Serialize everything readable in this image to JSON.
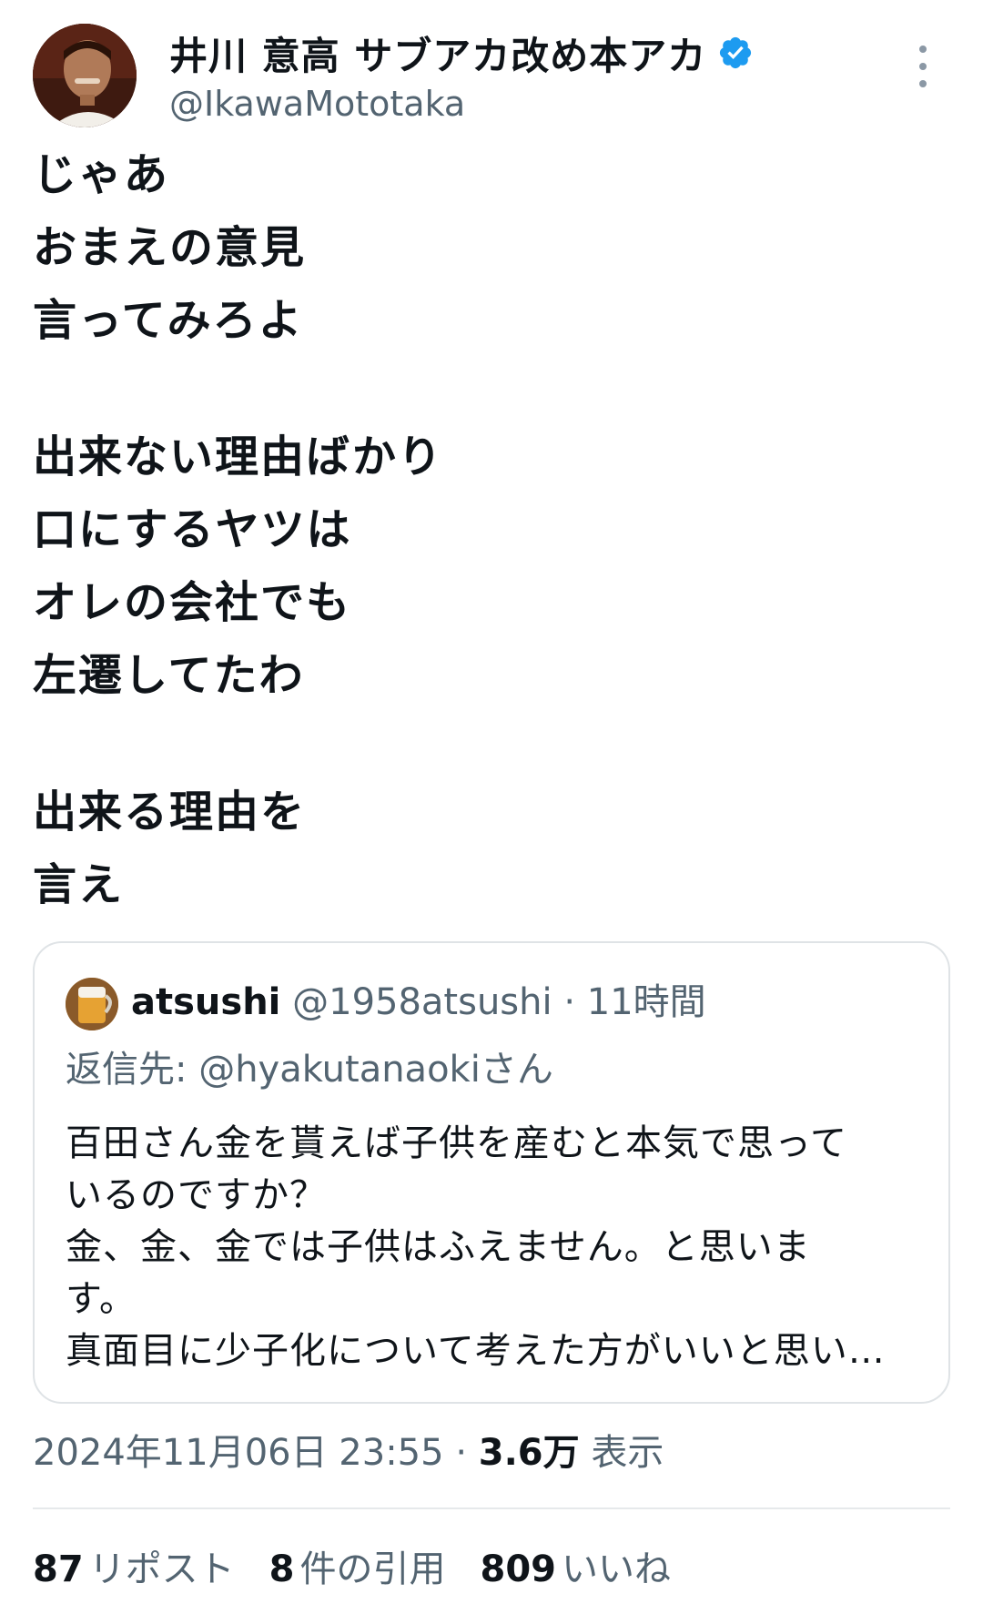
{
  "author": {
    "display_name": "井川 意高 サブアカ改め本アカ",
    "handle": "@IkawaMototaka",
    "verified": true
  },
  "tweet": {
    "lines": [
      "じゃあ",
      "おまえの意見",
      "言ってみろよ",
      "",
      "出来ない理由ばかり",
      "口にするヤツは",
      "オレの会社でも",
      "左遷してたわ",
      "",
      "出来る理由を",
      "言え"
    ]
  },
  "quoted": {
    "name": "atsushi",
    "handle": "@1958atsushi",
    "separator": "·",
    "time": "11時間",
    "reply_to": "返信先: @hyakutanaokiさん",
    "lines": [
      "百田さん金を貰えば子供を産むと本気で思って",
      "いるのですか？",
      "金、金、金では子供はふえません。と思いま",
      "す。",
      "真面目に少子化について考えた方がいいと思い…"
    ]
  },
  "meta": {
    "datetime": "2024年11月06日 23:55",
    "separator": "·",
    "views_count": "3.6万",
    "views_label": "表示"
  },
  "stats": {
    "reposts": {
      "count": "87",
      "label": "リポスト"
    },
    "quotes": {
      "count": "8",
      "label": "件の引用"
    },
    "likes": {
      "count": "809",
      "label": "いいね"
    }
  },
  "colors": {
    "verified": "#1d9bf0",
    "secondary_text": "#536471",
    "primary_text": "#0f1419",
    "border": "#dfe3e6"
  },
  "icons": {
    "more": "more-vertical-icon",
    "verified": "verified-badge-icon"
  }
}
